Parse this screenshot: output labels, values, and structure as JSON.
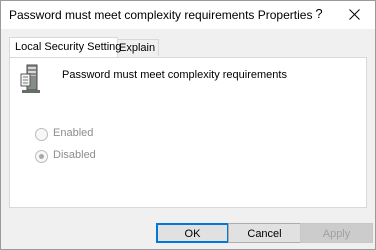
{
  "window": {
    "title": "Password must meet complexity requirements Properties",
    "help_glyph": "?",
    "close_icon": "close-icon"
  },
  "tabs": [
    {
      "label": "Local Security Setting",
      "active": true
    },
    {
      "label": "Explain",
      "active": false
    }
  ],
  "policy": {
    "icon": "server-policy-icon",
    "title": "Password must meet complexity requirements"
  },
  "options": [
    {
      "label": "Enabled",
      "selected": false,
      "disabled": true
    },
    {
      "label": "Disabled",
      "selected": true,
      "disabled": true
    }
  ],
  "buttons": {
    "ok": "OK",
    "cancel": "Cancel",
    "apply": "Apply"
  },
  "colors": {
    "accent": "#0078d7",
    "disabled_text": "#8d8d8d",
    "face": "#f0f0f0"
  }
}
